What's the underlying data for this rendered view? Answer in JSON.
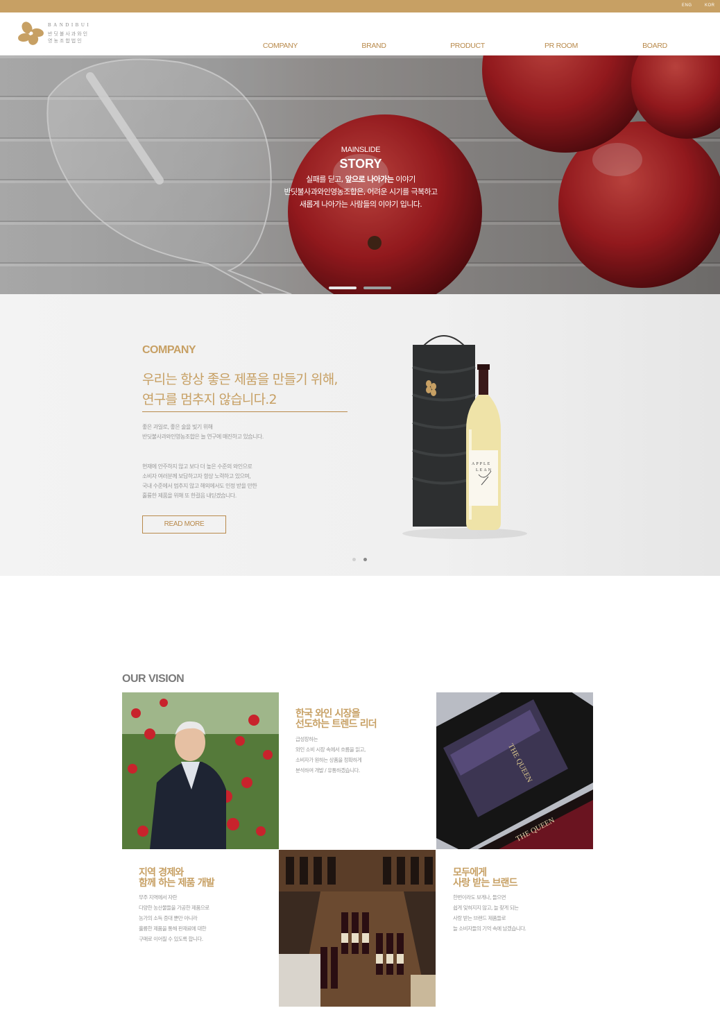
{
  "topbar": {
    "lang_en": "ENG",
    "lang_kr": "KOR"
  },
  "header": {
    "logo_en": "BANDIBUI",
    "logo_ko_line1": "반딧불사과와인",
    "logo_ko_line2": "영농조합법인",
    "nav": [
      "COMPANY",
      "BRAND",
      "PRODUCT",
      "PR ROOM",
      "BOARD"
    ]
  },
  "hero": {
    "eyebrow": "MAINSLIDE",
    "title": "STORY",
    "line1_pre": "실패를 딛고, ",
    "line1_bold": "앞으로 나아가는",
    "line1_post": " 이야기",
    "line2": "반딧불사과와인영농조합은, 어려운 시기를 극복하고",
    "line3": "새롭게 나아가는 사람들의 이야기 입니다."
  },
  "company": {
    "label": "COMPANY",
    "heading_line1": "우리는 항상 좋은 제품을 만들기 위해,",
    "heading_line2": "연구를 멈추지 않습니다.2",
    "para1": [
      "좋은 과일로, 좋은 술을 빚기 위해",
      "반딧불사과와인영농조합은 늘 연구에 매진하고 있습니다."
    ],
    "para2": [
      "현재에 안주하지 않고 보다 더 높은 수준의 와인으로",
      "소비자 여러분께 보답하고자 항상 노력하고 있으며,",
      "국내 수준에서 멈추지 않고 해외에서도 인정 받을 만한",
      "훌륭한 제품을 위해 또 한걸음 내딛겠습니다."
    ],
    "read_more": "READ MORE",
    "bottle_label_line1": "APPLE",
    "bottle_label_line2": "LEAN"
  },
  "vision": {
    "title": "OUR VISION",
    "card1": {
      "heading": [
        "한국 와인 시장을",
        "선도하는 트렌드 리더"
      ],
      "body": [
        "급성장하는",
        "와인 소비 시장 속에서 흐름을 읽고,",
        "소비자가 원하는 상품을 정확하게",
        "분석하여 개발 / 유통하겠습니다."
      ]
    },
    "card2": {
      "heading": [
        "지역 경제와",
        "함께 하는 제품 개발"
      ],
      "body": [
        "무주 지역에서 자란",
        "다양한 농산물들을 가공한 제품으로",
        "농가의 소득 증대 뿐만 아니라",
        "훌륭한 제품을 통해 판재료에 대한",
        "구매로 이어질 수 있도록 합니다."
      ]
    },
    "card3": {
      "heading": [
        "모두에게",
        "사랑 받는 브랜드"
      ],
      "body": [
        "한번이라도 보게나, 들으면",
        "쉽게 잊혀지지 않고, 늘 찾게 되는",
        "사랑 받는 브랜드 제품들로",
        "늘 소비자들의 기억 속에 남겠습니다."
      ]
    },
    "wine_label": "THE QUEEN"
  }
}
